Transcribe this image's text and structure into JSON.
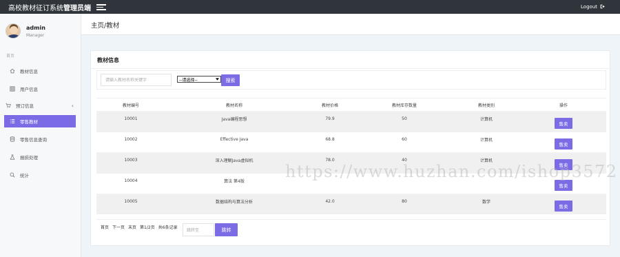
{
  "header": {
    "title_prefix": "高校教材征订系统",
    "title_bold": "管理员端",
    "logout_label": "Logout",
    "logout_icon": "sign-out-icon"
  },
  "user": {
    "name": "admin",
    "role": "Manager"
  },
  "sidebar": {
    "section_label": "首页",
    "items": [
      {
        "label": "教材信息",
        "icon": "home-icon"
      },
      {
        "label": "用户信息",
        "icon": "grid-icon"
      },
      {
        "label": "预订信息",
        "icon": "cart-icon"
      },
      {
        "label": "零售教材",
        "icon": "list-icon"
      },
      {
        "label": "零售信息查询",
        "icon": "database-icon"
      },
      {
        "label": "报损处理",
        "icon": "flask-icon"
      },
      {
        "label": "统计",
        "icon": "search-icon"
      }
    ]
  },
  "breadcrumb": "主页/教材",
  "card": {
    "title": "教材信息"
  },
  "search": {
    "placeholder": "请输入教材名称关键字",
    "select_value": "--请选择--",
    "button_label": "搜索"
  },
  "table": {
    "headers": [
      "教材编号",
      "教材名称",
      "教材价格",
      "教材库存数量",
      "教材类别",
      "操作"
    ],
    "rows": [
      {
        "id": "10001",
        "name": "Java编程思想",
        "price": "79.9",
        "stock": "50",
        "category": "计算机",
        "action": "售卖"
      },
      {
        "id": "10002",
        "name": "Effective Java",
        "price": "68.8",
        "stock": "60",
        "category": "计算机",
        "action": "售卖"
      },
      {
        "id": "10003",
        "name": "深入理解Java虚拟机",
        "price": "78.0",
        "stock": "40",
        "category": "计算机",
        "action": "售卖"
      },
      {
        "id": "10004",
        "name": "算法 第4版",
        "price": "",
        "stock": "",
        "category": "",
        "action": "售卖"
      },
      {
        "id": "10005",
        "name": "数据结构与算法分析",
        "price": "42.0",
        "stock": "80",
        "category": "数学",
        "action": "售卖"
      }
    ]
  },
  "pager": {
    "first": "首页",
    "next": "下一页",
    "last": "末页",
    "page_info": "第1/2页",
    "total": "共6条记录",
    "jump_placeholder": "跳转至",
    "jump_label": "跳转"
  },
  "watermark": "https://www.huzhan.com/ishop3572"
}
